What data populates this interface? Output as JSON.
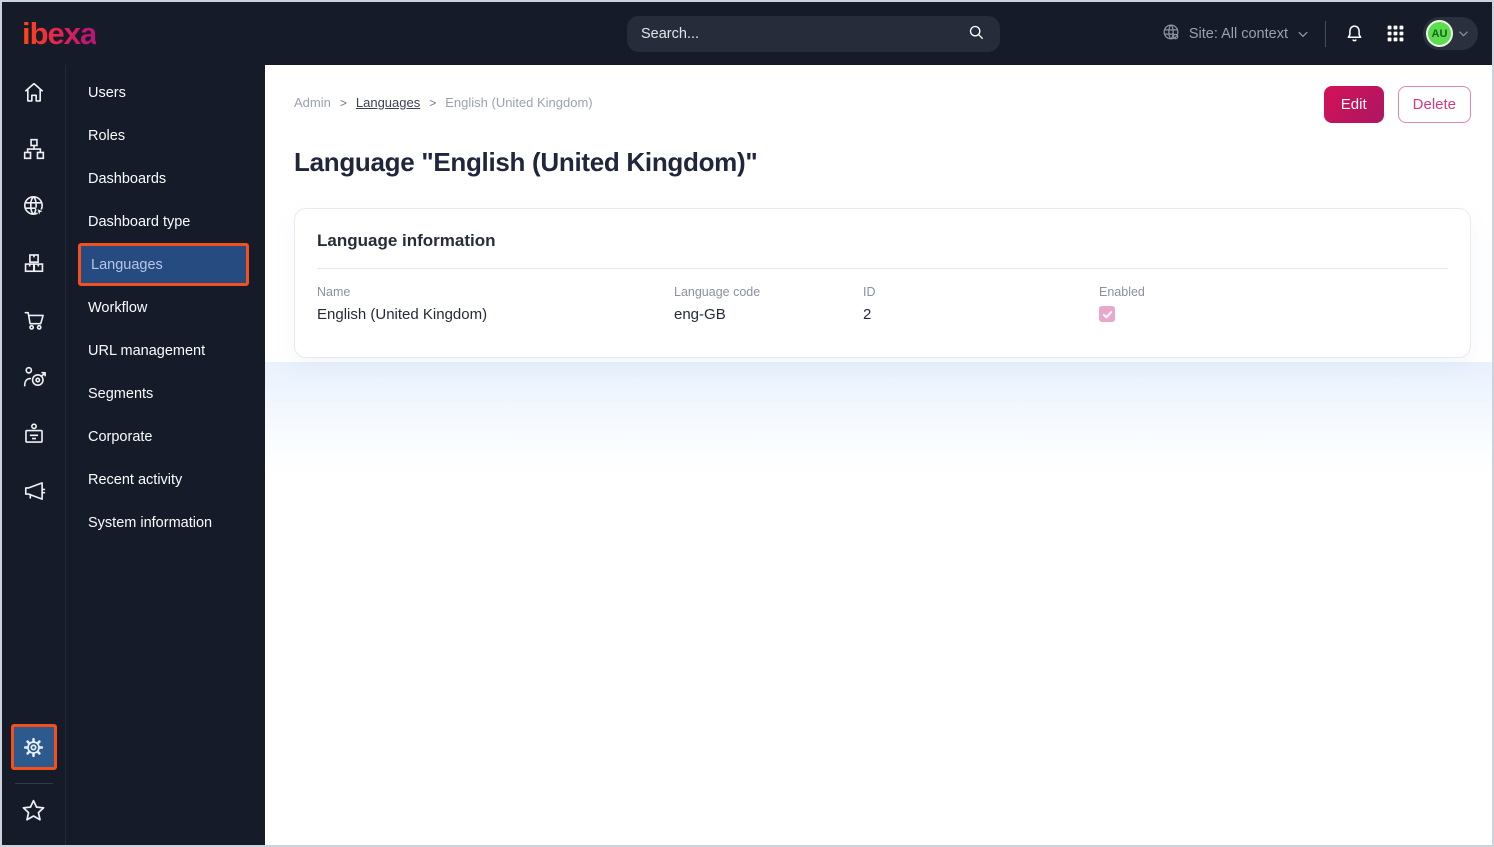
{
  "topbar": {
    "logo_text": "ibexa",
    "search_placeholder": "Search...",
    "site_context_label": "Site: All context",
    "avatar_initials": "AU"
  },
  "sidebar_icons": [
    "home",
    "content-structure",
    "site",
    "products",
    "commerce",
    "personalization",
    "corporate",
    "marketing",
    "settings",
    "bookmarks"
  ],
  "menu": {
    "items": [
      "Users",
      "Roles",
      "Dashboards",
      "Dashboard type",
      "Languages",
      "Workflow",
      "URL management",
      "Segments",
      "Corporate",
      "Recent activity",
      "System information"
    ],
    "selected": "Languages"
  },
  "breadcrumb": {
    "items": [
      "Admin",
      "Languages",
      "English (United Kingdom)"
    ],
    "separator": ">"
  },
  "actions": {
    "edit_label": "Edit",
    "delete_label": "Delete"
  },
  "page": {
    "title": "Language \"English (United Kingdom)\""
  },
  "card": {
    "title": "Language information",
    "fields": [
      {
        "label": "Name",
        "value": "English (United Kingdom)"
      },
      {
        "label": "Language code",
        "value": "eng-GB"
      },
      {
        "label": "ID",
        "value": "2"
      },
      {
        "label": "Enabled",
        "value": "checked"
      }
    ]
  },
  "colors": {
    "topbar_bg": "#161b29",
    "accent_pink": "#c2155b",
    "annotation_orange": "#f4501e",
    "selected_blue": "#264b80",
    "avatar_green": "#5ddc4d",
    "checkbox_pink": "#e8a8cb"
  }
}
